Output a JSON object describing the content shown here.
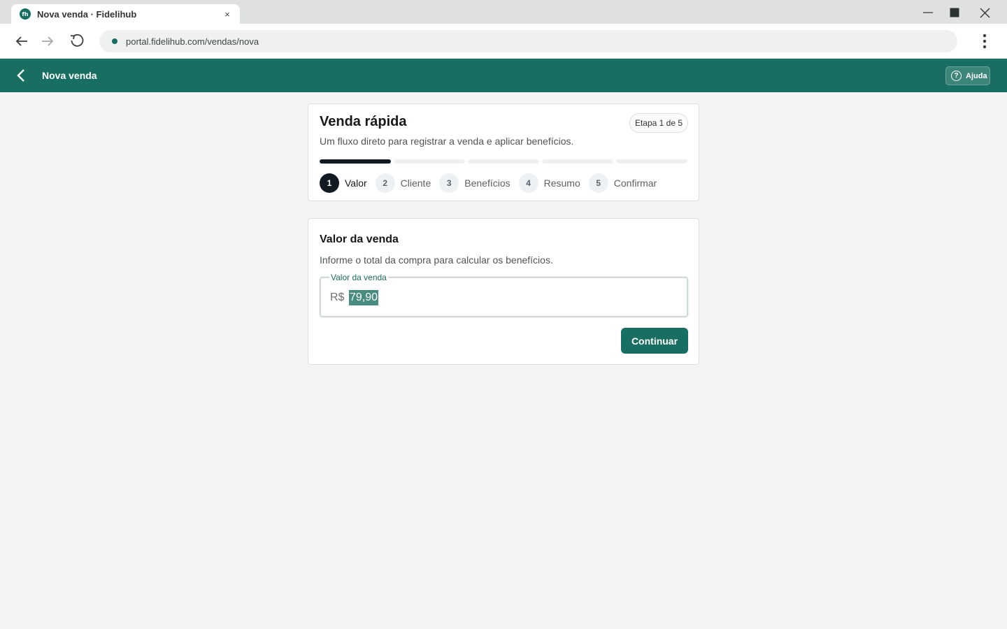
{
  "browser": {
    "tab_title": "Nova venda · Fidelihub",
    "favicon_text": "fh",
    "tab_close": "×",
    "url": "portal.fidelihub.com/vendas/nova"
  },
  "header": {
    "title": "Nova venda",
    "help_label": "Ajuda",
    "help_icon_glyph": "?"
  },
  "stepper_card": {
    "title": "Venda rápida",
    "subtitle": "Um fluxo direto para registrar a venda e aplicar benefícios.",
    "etapa": "Etapa 1 de 5",
    "current_step": 1,
    "total_steps": 5,
    "steps": [
      {
        "num": "1",
        "label": "Valor"
      },
      {
        "num": "2",
        "label": "Cliente"
      },
      {
        "num": "3",
        "label": "Benefícios"
      },
      {
        "num": "4",
        "label": "Resumo"
      },
      {
        "num": "5",
        "label": "Confirmar"
      }
    ]
  },
  "value_card": {
    "title": "Valor da venda",
    "description": "Informe o total da compra para calcular os benefícios.",
    "field_label": "Valor da venda",
    "currency": "R$",
    "amount": "79,90",
    "continue_label": "Continuar"
  },
  "colors": {
    "brand": "#176e61",
    "step_active": "#111a23",
    "page_bg": "#f3f4f3"
  }
}
